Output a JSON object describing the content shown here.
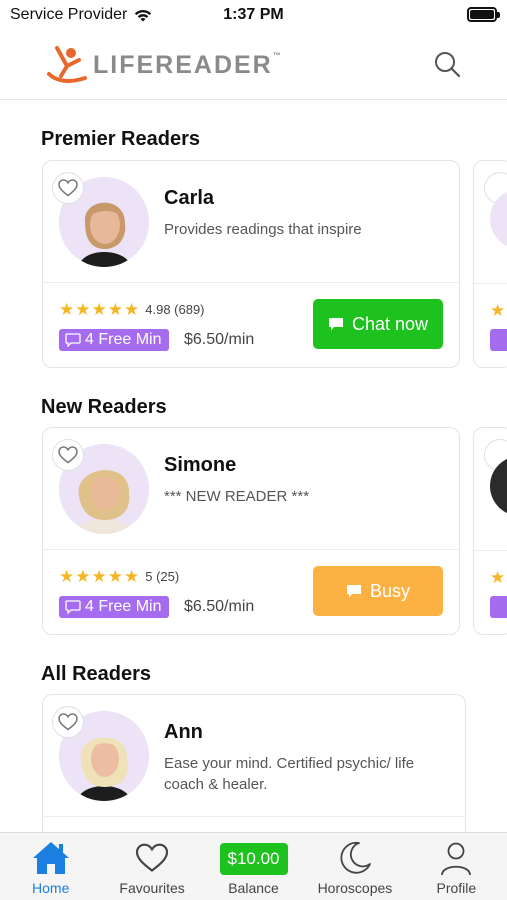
{
  "status_bar": {
    "carrier": "Service Provider",
    "time": "1:37 PM"
  },
  "header": {
    "logo_text": "LIFEREADER",
    "logo_tm": "™"
  },
  "sections": {
    "premier": {
      "title": "Premier Readers",
      "reader": {
        "name": "Carla",
        "description": "Provides readings that inspire",
        "rating": "4.98 (689)",
        "free_minutes": "4 Free Min",
        "price": "$6.50/min",
        "action": "Chat now"
      }
    },
    "new": {
      "title": "New Readers",
      "reader": {
        "name": "Simone",
        "description": "*** NEW READER ***",
        "rating": "5 (25)",
        "free_minutes": "4 Free Min",
        "price": "$6.50/min",
        "action": "Busy"
      }
    },
    "all": {
      "title": "All Readers",
      "reader": {
        "name": "Ann",
        "description": "Ease your mind. Certified psychic/ life coach & healer."
      }
    }
  },
  "tabs": [
    {
      "label": "Home",
      "icon": "home-icon",
      "active": true
    },
    {
      "label": "Favourites",
      "icon": "heart-icon"
    },
    {
      "label": "Balance",
      "value": "$10.00"
    },
    {
      "label": "Horoscopes",
      "icon": "moon-icon"
    },
    {
      "label": "Profile",
      "icon": "person-icon"
    }
  ],
  "colors": {
    "chat": "#1ec21e",
    "busy": "#fbb243",
    "badge": "#a56cf0",
    "star": "#f5b623",
    "active_tab": "#1a7fe0",
    "logo_orange": "#e8672b"
  }
}
